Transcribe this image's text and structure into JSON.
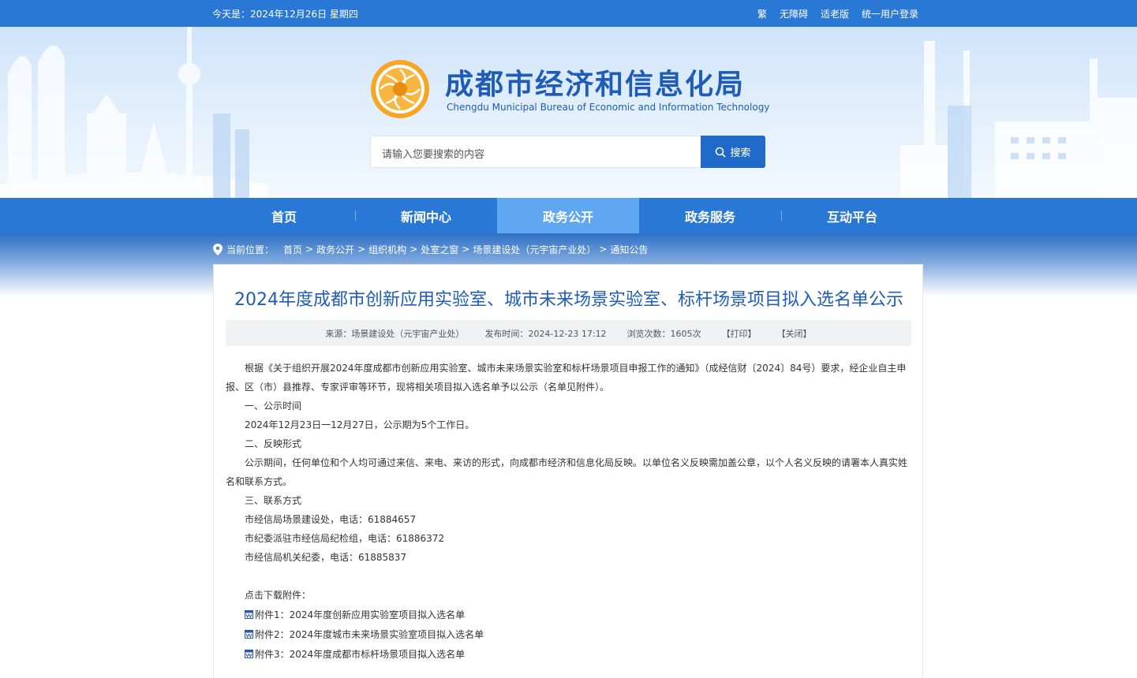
{
  "topbar": {
    "date": "今天是：2024年12月26日  星期四",
    "links": [
      "繁",
      "无障碍",
      "适老版",
      "统一用户登录"
    ]
  },
  "header": {
    "title_cn": "成都市经济和信息化局",
    "title_en": "Chengdu Municipal Bureau of Economic and Information Technology",
    "search_placeholder": "请输入您要搜索的内容",
    "search_button": "搜索"
  },
  "nav": {
    "items": [
      "首页",
      "新闻中心",
      "政务公开",
      "政务服务",
      "互动平台"
    ],
    "active": "政务公开"
  },
  "breadcrumb": {
    "label": "当前位置：",
    "items": [
      "首页",
      "政务公开",
      "组织机构",
      "处室之窗",
      "场景建设处（元宇宙产业处）",
      "通知公告"
    ]
  },
  "article": {
    "title": "2024年度成都市创新应用实验室、城市未来场景实验室、标杆场景项目拟入选名单公示",
    "meta": {
      "source": "来源：场景建设处（元宇宙产业处）",
      "time": "发布时间：2024-12-23 17:12",
      "views": "浏览次数：1605次",
      "print": "【打印】",
      "close": "【关闭】"
    },
    "intro": "根据《关于组织开展2024年度成都市创新应用实验室、城市未来场景实验室和标杆场景项目申报工作的通知》（成经信财〔2024〕84号）要求，经企业自主申报、区（市）县推荐、专家评审等环节，现将相关项目拟入选名单予以公示（名单见附件）。",
    "s1_title": "一、公示时间",
    "s1_text": "2024年12月23日一12月27日，公示期为5个工作日。",
    "s2_title": "二、反映形式",
    "s2_text": "公示期间，任何单位和个人均可通过来信、来电、来访的形式，向成都市经济和信息化局反映。以单位名义反映需加盖公章，以个人名义反映的请署本人真实姓名和联系方式。",
    "s3_title": "三、联系方式",
    "contacts": [
      "市经信局场景建设处，电话：61884657",
      "市纪委派驻市经信局纪检组，电话：61886372",
      "市经信局机关纪委，电话：61885837"
    ],
    "download_label": "点击下载附件：",
    "attachments": [
      "附件1：2024年度创新应用实验室项目拟入选名单",
      "附件2：2024年度城市未来场景实验室项目拟入选名单",
      "附件3：2024年度成都市标杆场景项目拟入选名单"
    ]
  },
  "colors": {
    "primary": "#2a78d6",
    "nav_active": "#5fa7f0",
    "title": "#1e5cb8",
    "search_button": "#1f69c8"
  }
}
